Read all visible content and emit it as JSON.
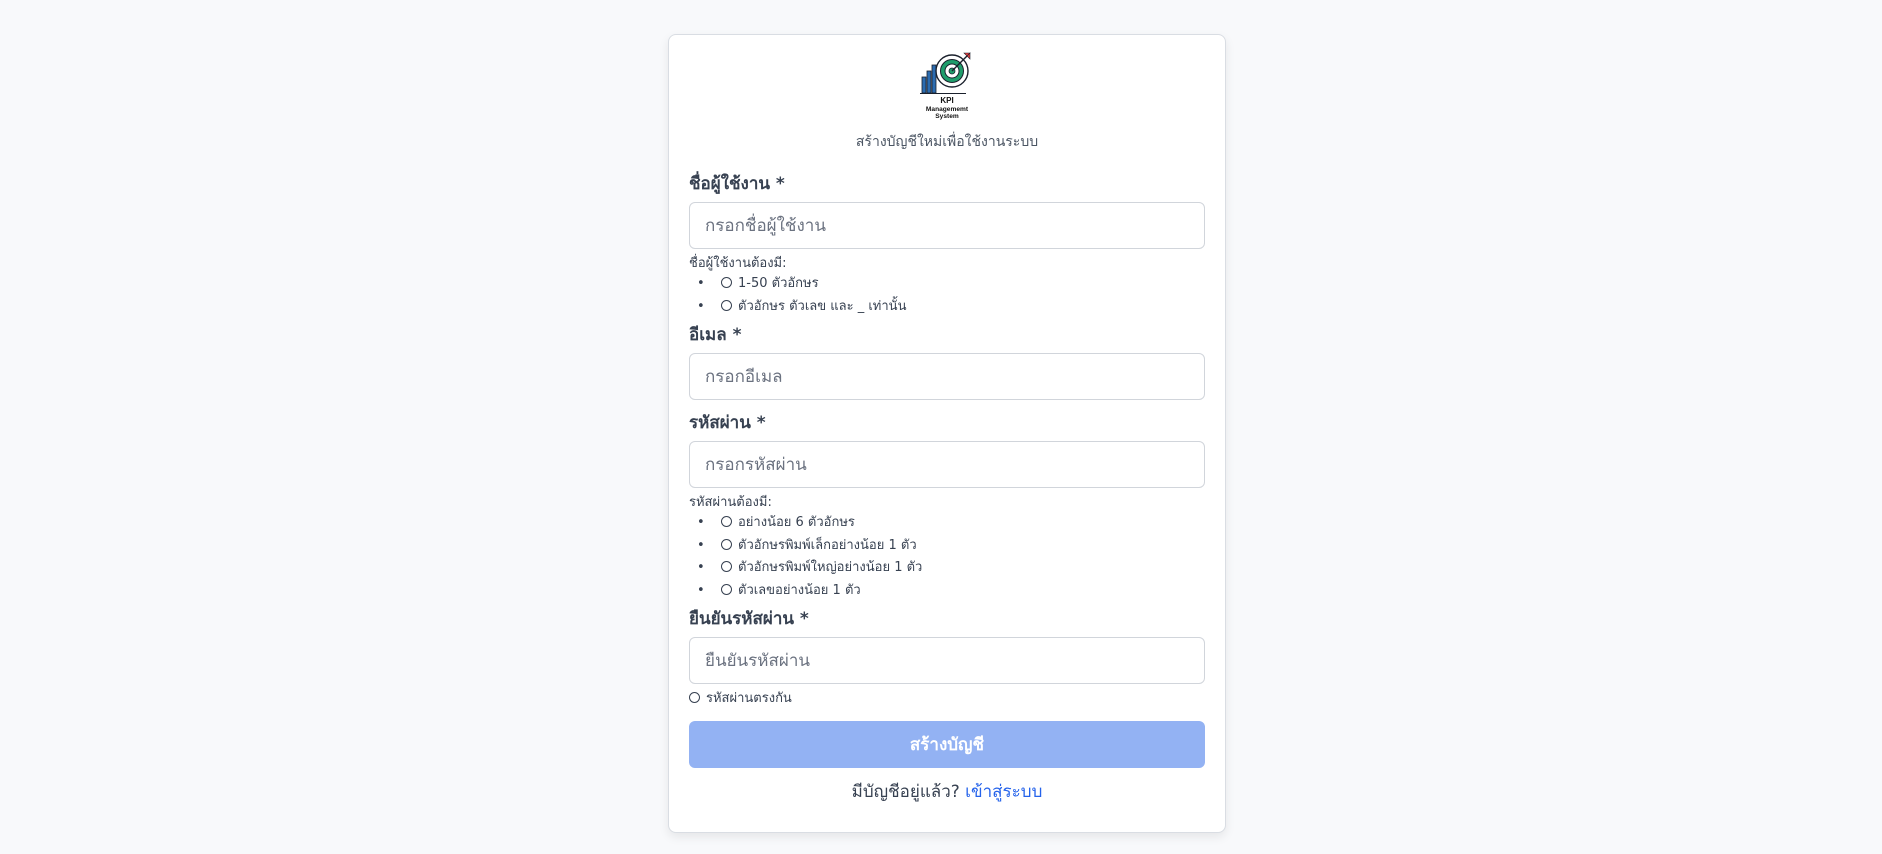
{
  "header": {
    "logo_text_line1": "KPI",
    "logo_text_line2": "Managememt",
    "logo_text_line3": "System",
    "subtitle": "สร้างบัญชีใหม่เพื่อใช้งานระบบ"
  },
  "form": {
    "username": {
      "label": "ชื่อผู้ใช้งาน *",
      "placeholder": "กรอกชื่อผู้ใช้งาน",
      "value": "",
      "hint_title": "ชื่อผู้ใช้งานต้องมี:",
      "rules": [
        "1-50 ตัวอักษร",
        "ตัวอักษร ตัวเลข และ _ เท่านั้น"
      ]
    },
    "email": {
      "label": "อีเมล *",
      "placeholder": "กรอกอีเมล",
      "value": ""
    },
    "password": {
      "label": "รหัสผ่าน *",
      "placeholder": "กรอกรหัสผ่าน",
      "value": "",
      "hint_title": "รหัสผ่านต้องมี:",
      "rules": [
        "อย่างน้อย 6 ตัวอักษร",
        "ตัวอักษรพิมพ์เล็กอย่างน้อย 1 ตัว",
        "ตัวอักษรพิมพ์ใหญ่อย่างน้อย 1 ตัว",
        "ตัวเลขอย่างน้อย 1 ตัว"
      ]
    },
    "confirm_password": {
      "label": "ยืนยันรหัสผ่าน *",
      "placeholder": "ยืนยันรหัสผ่าน",
      "value": "",
      "match_hint": "รหัสผ่านตรงกัน"
    },
    "submit_label": "สร้างบัญชี"
  },
  "footer": {
    "prompt": "มีบัญชีอยู่แล้ว?",
    "login_link": "เข้าสู่ระบบ"
  },
  "colors": {
    "accent": "#2563eb",
    "button_disabled": "#93b2f3",
    "logo_target": "#1f9d6b",
    "logo_bars": "#2b6cb0",
    "logo_dart": "#e53e3e"
  },
  "icons": {
    "rule_status": "circle-outline-icon",
    "logo": "kpi-target-logo"
  }
}
